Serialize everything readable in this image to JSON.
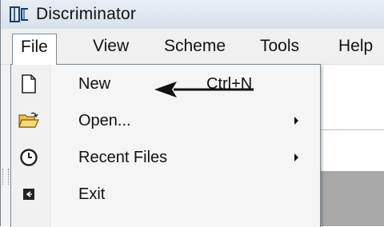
{
  "window": {
    "title": "Discriminator",
    "app_icon": "bc-logo-icon"
  },
  "menubar": {
    "items": [
      {
        "label": "File",
        "open": true
      },
      {
        "label": "View"
      },
      {
        "label": "Scheme"
      },
      {
        "label": "Tools"
      },
      {
        "label": "Help"
      }
    ]
  },
  "file_menu": {
    "items": [
      {
        "label": "New",
        "shortcut": "Ctrl+N",
        "icon": "new-file-icon",
        "submenu": false
      },
      {
        "label": "Open...",
        "shortcut": "",
        "icon": "open-folder-icon",
        "submenu": true
      },
      {
        "label": "Recent Files",
        "shortcut": "",
        "icon": "clock-icon",
        "submenu": true
      },
      {
        "label": "Exit",
        "shortcut": "",
        "icon": "exit-icon",
        "submenu": false
      }
    ]
  },
  "annotation": {
    "icon": "left-arrow-annotation-icon",
    "color": "#111111"
  },
  "colors": {
    "title_bar": "#d9e4f1",
    "menu_bg": "#f0f0f0",
    "dropdown_bg": "#f5f5f5",
    "panel_gray": "#a9a9a9"
  }
}
